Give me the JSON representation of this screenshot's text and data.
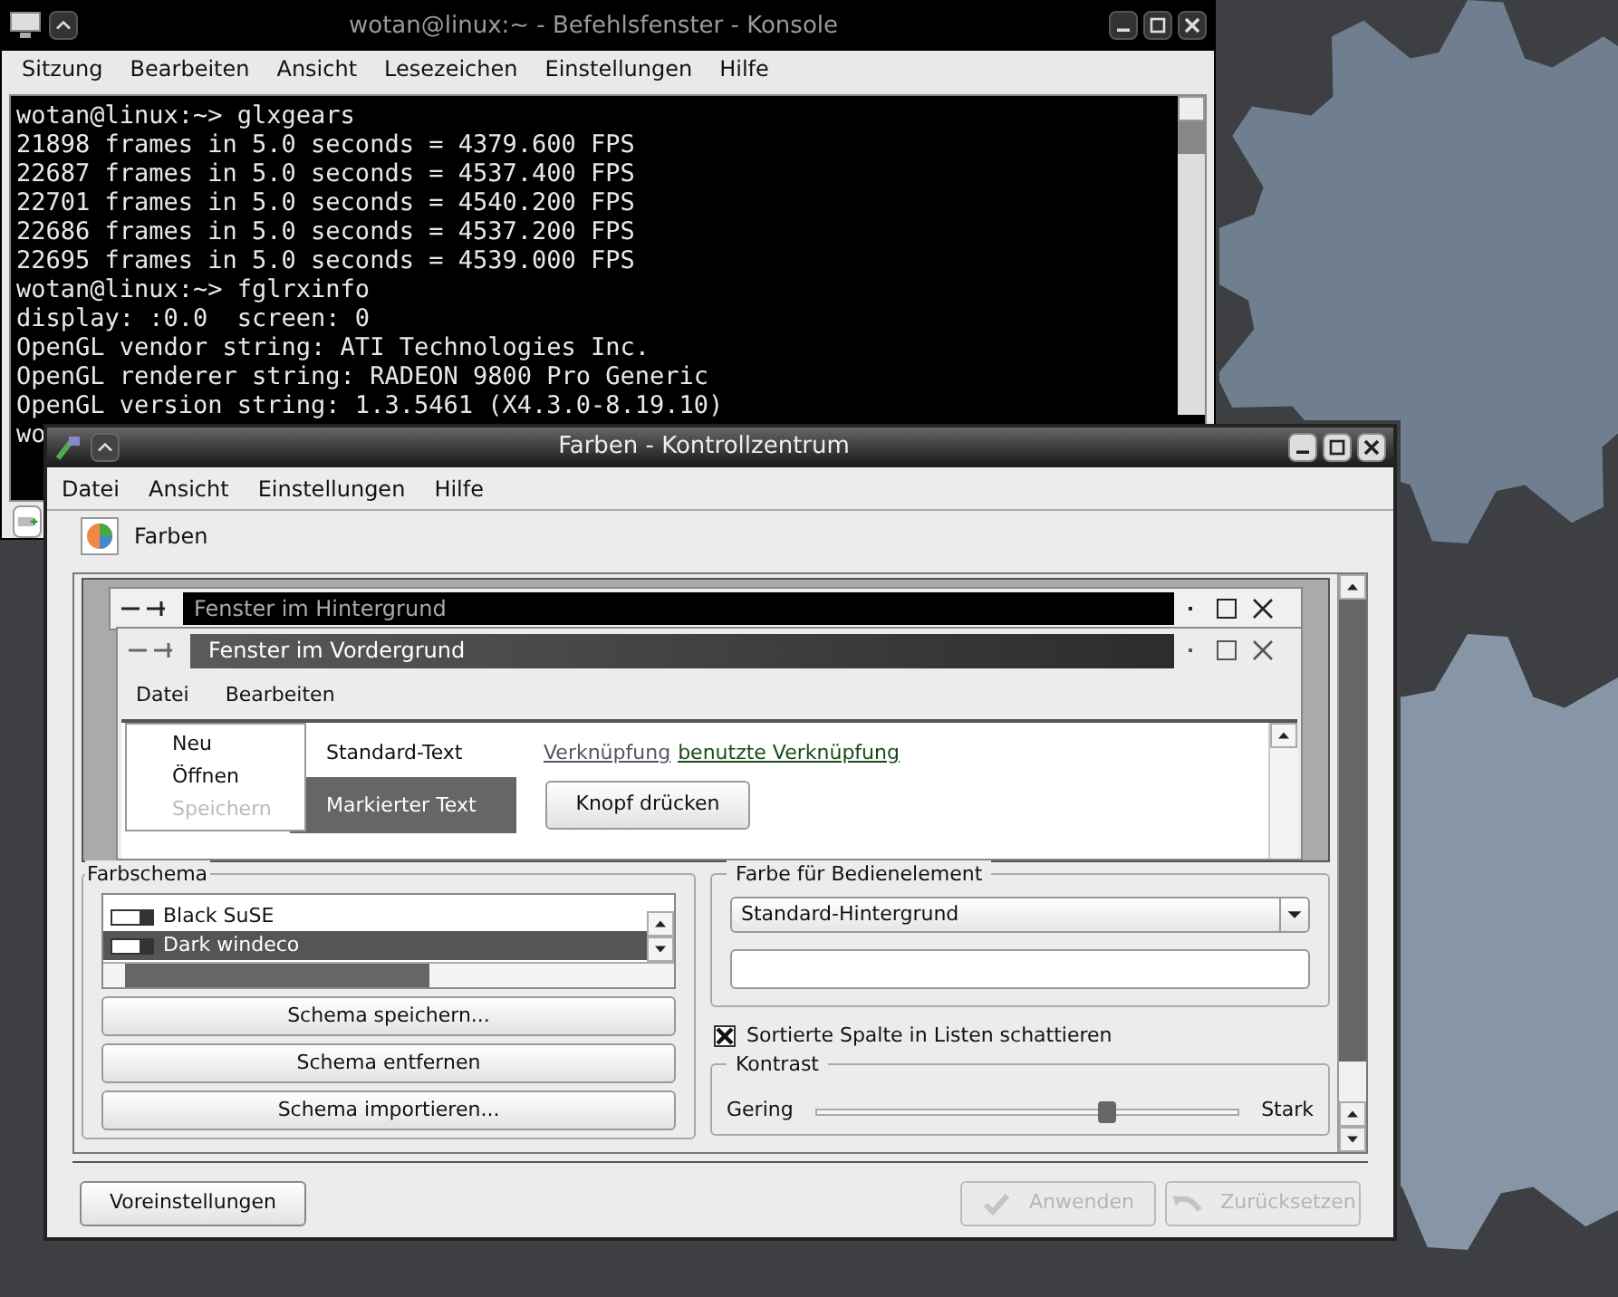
{
  "console": {
    "title": "wotan@linux:~ - Befehlsfenster - Konsole",
    "menu": [
      "Sitzung",
      "Bearbeiten",
      "Ansicht",
      "Lesezeichen",
      "Einstellungen",
      "Hilfe"
    ],
    "lines": [
      "wotan@linux:~> glxgears",
      "21898 frames in 5.0 seconds = 4379.600 FPS",
      "22687 frames in 5.0 seconds = 4537.400 FPS",
      "22701 frames in 5.0 seconds = 4540.200 FPS",
      "22686 frames in 5.0 seconds = 4537.200 FPS",
      "22695 frames in 5.0 seconds = 4539.000 FPS",
      "wotan@linux:~> fglrxinfo",
      "display: :0.0  screen: 0",
      "OpenGL vendor string: ATI Technologies Inc.",
      "OpenGL renderer string: RADEON 9800 Pro Generic",
      "OpenGL version string: 1.3.5461 (X4.3.0-8.19.10)",
      "wo"
    ]
  },
  "control_center": {
    "title": "Farben - Kontrollzentrum",
    "menu": [
      "Datei",
      "Ansicht",
      "Einstellungen",
      "Hilfe"
    ],
    "module": "Farben",
    "preview": {
      "inactive_title": "Fenster im Hintergrund",
      "active_title": "Fenster im Vordergrund",
      "menu": [
        "Datei",
        "Bearbeiten"
      ],
      "popup": [
        {
          "label": "Neu",
          "disabled": false
        },
        {
          "label": "Öffnen",
          "disabled": false
        },
        {
          "label": "Speichern",
          "disabled": true
        }
      ],
      "standard_text": "Standard-Text",
      "selected_text": "Markierter Text",
      "link": "Verknüpfung",
      "visited_link": "benutzte Verknüpfung",
      "button": "Knopf drücken"
    },
    "scheme": {
      "title": "Farbschema",
      "items": [
        {
          "label": "Black SuSE",
          "selected": false
        },
        {
          "label": "Dark windeco",
          "selected": true
        }
      ],
      "buttons": [
        "Schema speichern...",
        "Schema entfernen",
        "Schema importieren..."
      ]
    },
    "element_color": {
      "title": "Farbe für Bedienelement",
      "value": "Standard-Hintergrund"
    },
    "sort_shading": {
      "label": "Sortierte Spalte in Listen schattieren",
      "checked": true
    },
    "contrast": {
      "title": "Kontrast",
      "low": "Gering",
      "high": "Stark",
      "level": 0.69
    },
    "buttons": [
      {
        "label": "Voreinstellungen",
        "disabled": false,
        "kind": "plain"
      },
      {
        "label": "Anwenden",
        "disabled": true,
        "kind": "apply"
      },
      {
        "label": "Zurücksetzen",
        "disabled": true,
        "kind": "reset"
      }
    ]
  }
}
